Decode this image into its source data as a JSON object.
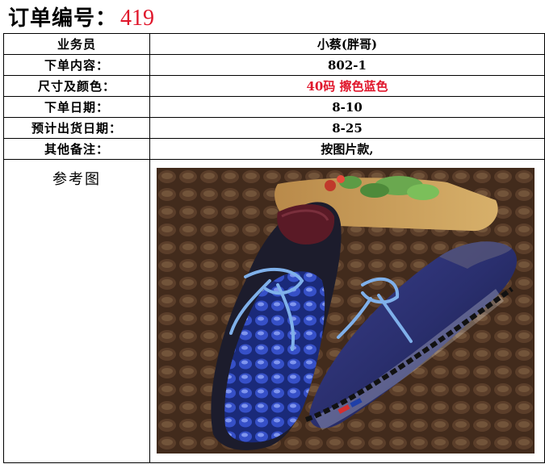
{
  "header": {
    "label": "订单编号：",
    "number": "419"
  },
  "rows": [
    {
      "label": "业务员",
      "value": "小蔡(胖哥)"
    },
    {
      "label": "下单内容：",
      "value": "802-1"
    },
    {
      "label": "尺寸及颜色：",
      "value": "40码 擦色蓝色"
    },
    {
      "label": "下单日期：",
      "value": "8-10"
    },
    {
      "label": "预计出货日期：",
      "value": "8-25"
    },
    {
      "label": "其他备注：",
      "value": "按图片款,"
    }
  ],
  "reference": {
    "label": "参考图"
  },
  "colors": {
    "accent_red": "#e0162b",
    "shoe_blue": "#2b3fa8",
    "lace_blue": "#6fa3e0",
    "leather_brown": "#5a3a26"
  }
}
